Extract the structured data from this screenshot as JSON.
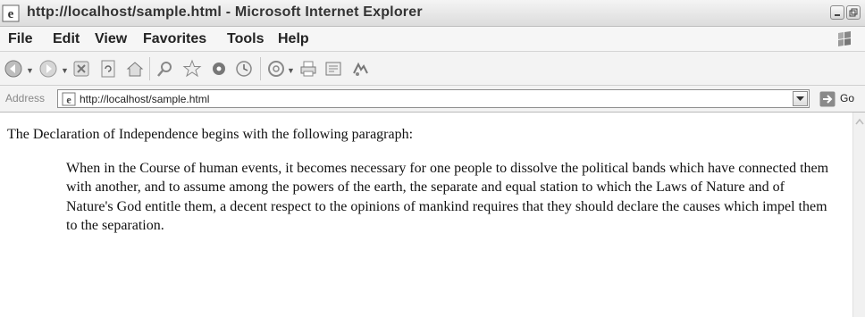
{
  "window": {
    "title": "http://localhost/sample.html - Microsoft Internet Explorer"
  },
  "menu": {
    "items": [
      "File",
      "Edit",
      "View",
      "Favorites",
      "Tools",
      "Help"
    ]
  },
  "toolbar": {
    "icons": [
      "back-icon",
      "forward-icon",
      "stop-icon",
      "refresh-icon",
      "home-icon",
      "search-icon",
      "favorites-icon",
      "media-icon",
      "history-icon",
      "mail-icon",
      "print-icon",
      "edit-icon",
      "discuss-icon"
    ]
  },
  "address": {
    "label": "Address",
    "url": "http://localhost/sample.html",
    "go_label": "Go"
  },
  "content": {
    "intro": "The Declaration of Independence begins with the following paragraph:",
    "quote": "When in the Course of human events, it becomes necessary for one people to dissolve the political bands which have connected them with another, and to assume among the powers of the earth, the separate and equal station to which the Laws of Nature and of Nature's God entitle them, a decent respect to the opinions of mankind requires that they should declare the causes which impel them to the separation."
  }
}
